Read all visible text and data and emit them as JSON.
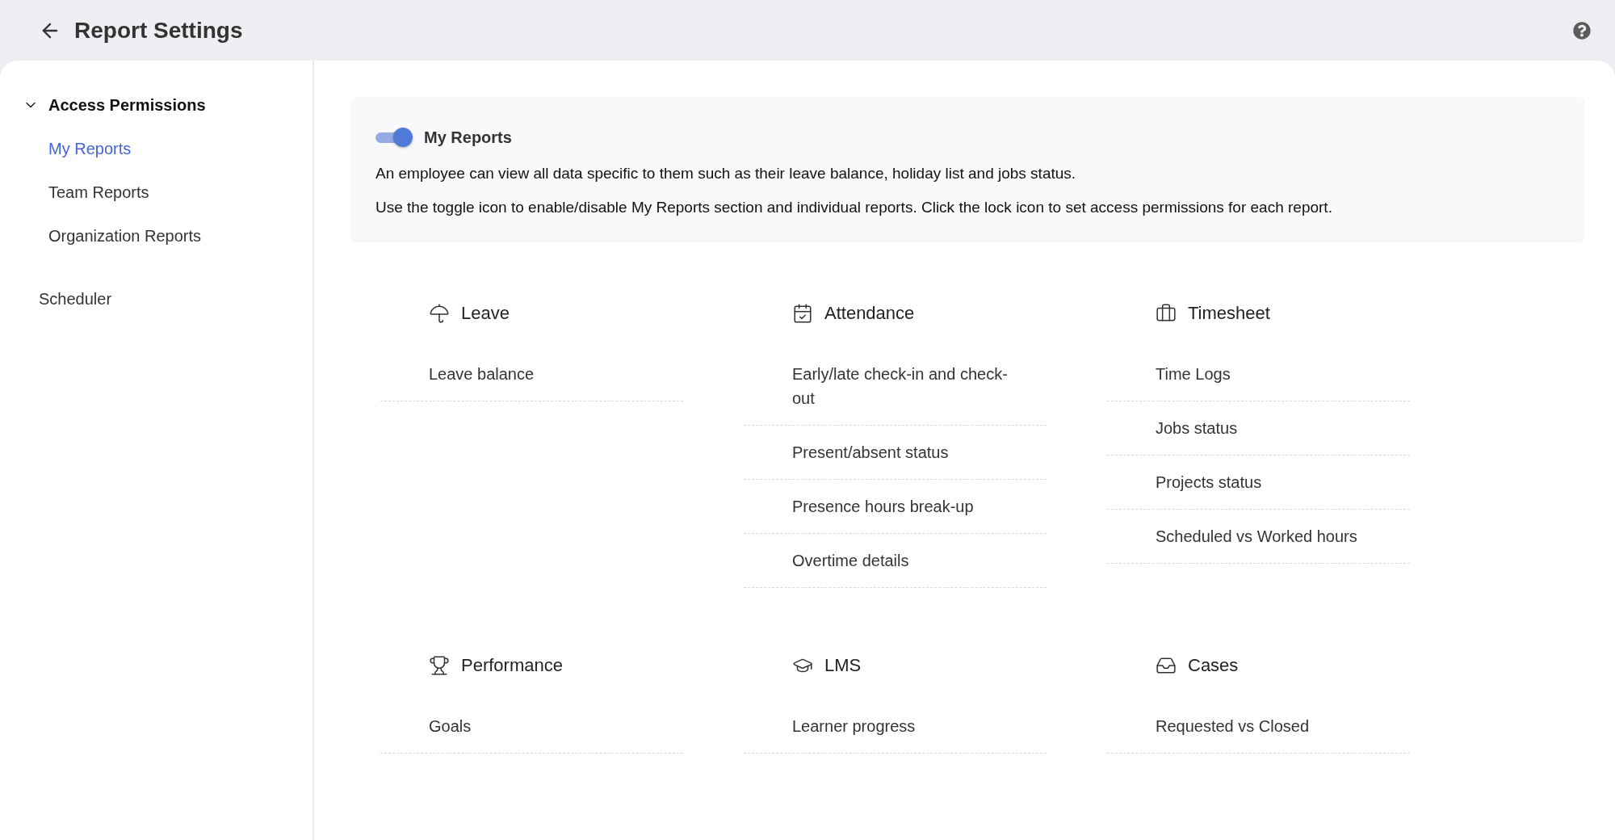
{
  "header": {
    "title": "Report Settings"
  },
  "sidebar": {
    "groups": [
      {
        "label": "Access Permissions",
        "expanded": true,
        "children": [
          {
            "label": "My Reports",
            "selected": true
          },
          {
            "label": "Team Reports",
            "selected": false
          },
          {
            "label": "Organization Reports",
            "selected": false
          }
        ]
      }
    ],
    "items": [
      {
        "label": "Scheduler",
        "selected": false
      }
    ]
  },
  "intro": {
    "title": "My Reports",
    "on": true,
    "paragraphs": [
      "An employee can view all data specific to them such as their leave balance, holiday list and jobs status.",
      "Use the toggle icon to enable/disable My Reports section and individual reports. Click the lock icon to set access permissions for each report."
    ]
  },
  "sections": [
    {
      "title": "Leave",
      "reports": [
        "Leave balance"
      ]
    },
    {
      "title": "Attendance",
      "reports": [
        "Early/late check-in and check-out",
        "Present/absent status",
        "Presence hours break-up",
        "Overtime details"
      ]
    },
    {
      "title": "Timesheet",
      "reports": [
        "Time Logs",
        "Jobs status",
        "Projects status",
        "Scheduled vs Worked hours"
      ]
    },
    {
      "title": "Performance",
      "reports": [
        "Goals"
      ]
    },
    {
      "title": "LMS",
      "reports": [
        "Learner progress"
      ]
    },
    {
      "title": "Cases",
      "reports": [
        "Requested vs Closed"
      ]
    }
  ]
}
